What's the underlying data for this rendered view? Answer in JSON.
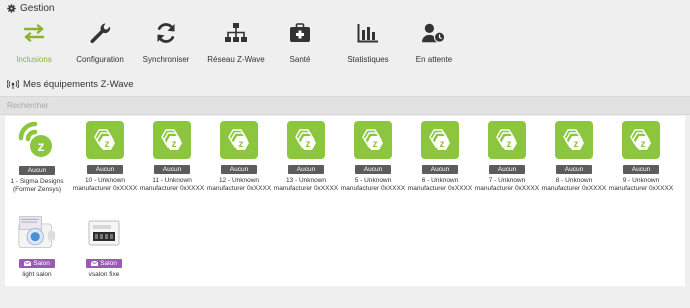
{
  "header": {
    "title": "Gestion",
    "icon": "gear-icon"
  },
  "toolbar": {
    "items": [
      {
        "label": "Inclusions",
        "icon": "arrows-exchange-icon",
        "active": true
      },
      {
        "label": "Configuration",
        "icon": "wrench-icon",
        "active": false
      },
      {
        "label": "Synchroniser",
        "icon": "refresh-icon",
        "active": false
      },
      {
        "label": "Réseau Z-Wave",
        "icon": "network-icon",
        "active": false
      },
      {
        "label": "Santé",
        "icon": "medkit-icon",
        "active": false
      },
      {
        "label": "Statistiques",
        "icon": "bar-chart-icon",
        "active": false
      },
      {
        "label": "En attente",
        "icon": "user-clock-icon",
        "active": false
      }
    ]
  },
  "section": {
    "title": "Mes équipements Z-Wave",
    "icon": "zwave-antenna-icon"
  },
  "search": {
    "placeholder": "Rechercher"
  },
  "colors": {
    "accent": "#8cb32c",
    "tile": "#8cc63f",
    "badge": "#5c5c5c",
    "room_badge": "#9b59b6"
  },
  "devices": [
    {
      "badge": "Aucun",
      "name": "1 - Sigma Designs (Former Zensys)",
      "icon": "zwave-controller-icon"
    },
    {
      "badge": "Aucun",
      "name": "10 - Unknown manufacturer 0xXXXX",
      "icon": "zwave-logo-icon"
    },
    {
      "badge": "Aucun",
      "name": "11 - Unknown manufacturer 0xXXXX",
      "icon": "zwave-logo-icon"
    },
    {
      "badge": "Aucun",
      "name": "12 - Unknown manufacturer 0xXXXX",
      "icon": "zwave-logo-icon"
    },
    {
      "badge": "Aucun",
      "name": "13 - Unknown manufacturer 0xXXXX",
      "icon": "zwave-logo-icon"
    },
    {
      "badge": "Aucun",
      "name": "5 - Unknown manufacturer 0xXXXX",
      "icon": "zwave-logo-icon"
    },
    {
      "badge": "Aucun",
      "name": "6 - Unknown manufacturer 0xXXXX",
      "icon": "zwave-logo-icon"
    },
    {
      "badge": "Aucun",
      "name": "7 - Unknown manufacturer 0xXXXX",
      "icon": "zwave-logo-icon"
    },
    {
      "badge": "Aucun",
      "name": "8 - Unknown manufacturer 0xXXXX",
      "icon": "zwave-logo-icon"
    },
    {
      "badge": "Aucun",
      "name": "9 - Unknown manufacturer 0xXXXX",
      "icon": "zwave-logo-icon"
    },
    {
      "badge": "Salon",
      "name": "light salon",
      "icon": "dimmer-module-icon"
    },
    {
      "badge": "Salon",
      "name": "vsalon fixe",
      "icon": "switch-module-icon"
    }
  ]
}
